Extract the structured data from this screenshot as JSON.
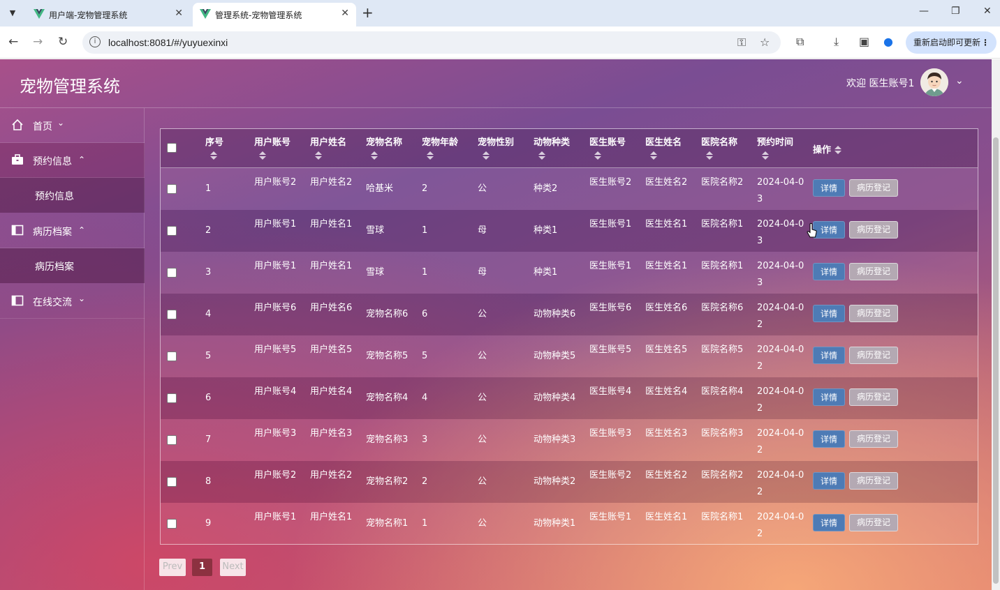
{
  "browser": {
    "tabs": [
      {
        "title": "用户端-宠物管理系统",
        "active": false
      },
      {
        "title": "管理系统-宠物管理系统",
        "active": true
      }
    ],
    "url": "localhost:8081/#/yuyuexinxi",
    "update_label": "重新启动即可更新"
  },
  "header": {
    "brand": "宠物管理系统",
    "welcome": "欢迎 医生账号1"
  },
  "sidebar": {
    "items": [
      {
        "label": "首页",
        "arrow": "⌄",
        "icon": "home-icon"
      },
      {
        "label": "预约信息",
        "arrow": "⌃",
        "icon": "briefcase-icon",
        "sub": "预约信息"
      },
      {
        "label": "病历档案",
        "arrow": "⌃",
        "icon": "panel-icon",
        "sub": "病历档案"
      },
      {
        "label": "在线交流",
        "arrow": "⌄",
        "icon": "panel-icon"
      }
    ]
  },
  "table": {
    "headers": [
      "序号",
      "用户账号",
      "用户姓名",
      "宠物名称",
      "宠物年龄",
      "宠物性别",
      "动物种类",
      "医生账号",
      "医生姓名",
      "医院名称",
      "预约时间",
      "操作"
    ],
    "rows": [
      [
        "1",
        "用户账号2",
        "用户姓名2",
        "哈基米",
        "2",
        "公",
        "种类2",
        "医生账号2",
        "医生姓名2",
        "医院名称2",
        "2024-04-03"
      ],
      [
        "2",
        "用户账号1",
        "用户姓名1",
        "雪球",
        "1",
        "母",
        "种类1",
        "医生账号1",
        "医生姓名1",
        "医院名称1",
        "2024-04-03"
      ],
      [
        "3",
        "用户账号1",
        "用户姓名1",
        "雪球",
        "1",
        "母",
        "种类1",
        "医生账号1",
        "医生姓名1",
        "医院名称1",
        "2024-04-03"
      ],
      [
        "4",
        "用户账号6",
        "用户姓名6",
        "宠物名称6",
        "6",
        "公",
        "动物种类6",
        "医生账号6",
        "医生姓名6",
        "医院名称6",
        "2024-04-02"
      ],
      [
        "5",
        "用户账号5",
        "用户姓名5",
        "宠物名称5",
        "5",
        "公",
        "动物种类5",
        "医生账号5",
        "医生姓名5",
        "医院名称5",
        "2024-04-02"
      ],
      [
        "6",
        "用户账号4",
        "用户姓名4",
        "宠物名称4",
        "4",
        "公",
        "动物种类4",
        "医生账号4",
        "医生姓名4",
        "医院名称4",
        "2024-04-02"
      ],
      [
        "7",
        "用户账号3",
        "用户姓名3",
        "宠物名称3",
        "3",
        "公",
        "动物种类3",
        "医生账号3",
        "医生姓名3",
        "医院名称3",
        "2024-04-02"
      ],
      [
        "8",
        "用户账号2",
        "用户姓名2",
        "宠物名称2",
        "2",
        "公",
        "动物种类2",
        "医生账号2",
        "医生姓名2",
        "医院名称2",
        "2024-04-02"
      ],
      [
        "9",
        "用户账号1",
        "用户姓名1",
        "宠物名称1",
        "1",
        "公",
        "动物种类1",
        "医生账号1",
        "医生姓名1",
        "医院名称1",
        "2024-04-02"
      ]
    ],
    "detail_label": "详情",
    "record_label": "病历登记"
  },
  "pagination": {
    "prev": "Prev",
    "current": "1",
    "next": "Next"
  },
  "colors": {
    "detail_button": "#4e7bb5",
    "record_button": "#b4a9b3",
    "current_page": "#8c3140"
  }
}
